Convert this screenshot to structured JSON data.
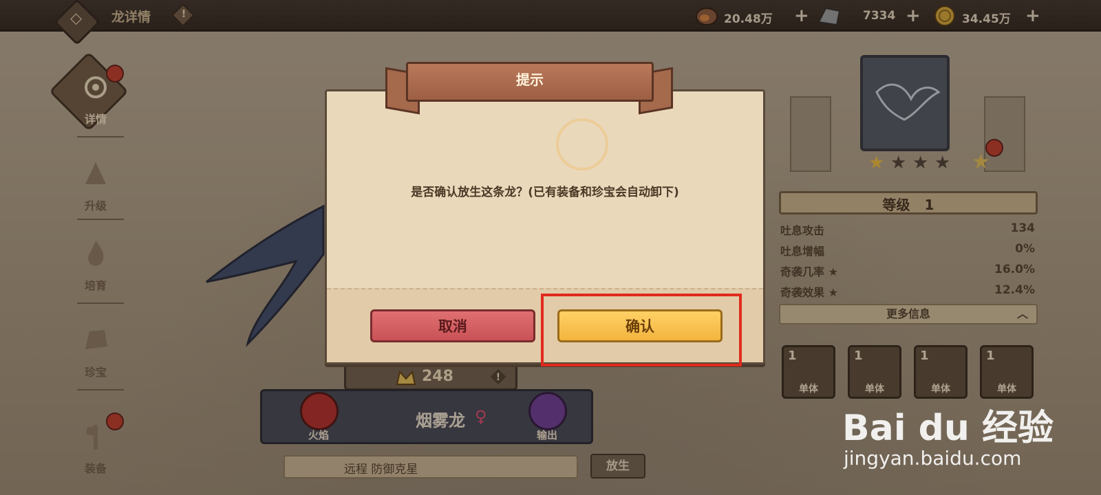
{
  "header": {
    "title": "龙详情",
    "info_glyph": "!",
    "back_glyph": "◇"
  },
  "resources": [
    {
      "icon": "meat-icon",
      "value": "20.48万",
      "plus": "+"
    },
    {
      "icon": "ore-icon",
      "value": "7334",
      "plus": "+"
    },
    {
      "icon": "gold-coin-icon",
      "value": "34.45万",
      "plus": "+"
    }
  ],
  "nav": [
    {
      "label": "详情",
      "icon": "dragon-emblem-icon"
    },
    {
      "label": "升级",
      "icon": "upgrade-icon"
    },
    {
      "label": "培育",
      "icon": "flame-icon"
    },
    {
      "label": "珍宝",
      "icon": "treasure-icon"
    },
    {
      "label": "装备",
      "icon": "axe-icon"
    }
  ],
  "dialog": {
    "title": "提示",
    "message": "是否确认放生这条龙？(已有装备和珍宝会自动卸下)",
    "cancel_label": "取消",
    "confirm_label": "确认"
  },
  "dragon": {
    "power": "248",
    "name": "烟雾龙",
    "gender": "♀",
    "element_left": "火焰",
    "element_right": "输出",
    "traits": "远程    防御克星",
    "release_label": "放生"
  },
  "panel": {
    "stars_filled": 1,
    "stars_total": 4,
    "level_label": "等级",
    "level_value": "1",
    "stats": [
      {
        "label": "吐息攻击",
        "value": "134"
      },
      {
        "label": "吐息增幅",
        "value": "0%"
      },
      {
        "label": "奇袭几率 ★",
        "value": "16.0%"
      },
      {
        "label": "奇袭效果 ★",
        "value": "12.4%"
      }
    ],
    "more_info": "更多信息",
    "skills": [
      {
        "level": "1",
        "type": "单体"
      },
      {
        "level": "1",
        "type": "单体"
      },
      {
        "level": "1",
        "type": "单体"
      },
      {
        "level": "1",
        "type": "单体"
      }
    ]
  },
  "watermark": {
    "logo": "Bai du 经验",
    "url": "jingyan.baidu.com"
  },
  "colors": {
    "cancel": "#d4605f",
    "confirm": "#f7be4a",
    "highlight": "#e02a1c"
  }
}
